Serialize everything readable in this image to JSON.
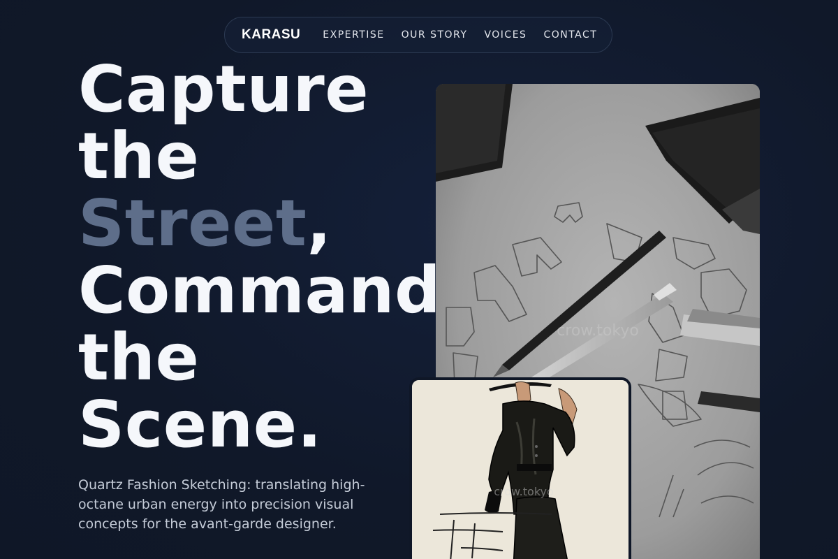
{
  "nav": {
    "brand": "KARASU",
    "links": [
      {
        "label": "EXPERTISE"
      },
      {
        "label": "OUR STORY"
      },
      {
        "label": "VOICES"
      },
      {
        "label": "CONTACT"
      }
    ]
  },
  "hero": {
    "headline": {
      "line1": "Capture",
      "line2": "the",
      "line3_accent": "Street",
      "line3_rest": ",",
      "line4": "Command",
      "line5": "the",
      "line6": "Scene."
    },
    "subtitle": "Quartz Fashion Sketching: translating high-octane urban energy into precision visual concepts for the avant-garde designer."
  },
  "images": {
    "main_alt": "Black and white photo of fashion sketches with pencils and pens on paper",
    "main_watermark": "crow.tokyo",
    "inset_alt": "Fashion illustration of a woman in a black belted jacket and hat",
    "inset_watermark": "crow.tokyo"
  },
  "colors": {
    "background": "#101829",
    "headline": "#f5f7fb",
    "accent": "#5e6e8a",
    "subtitle": "#c5ccd8",
    "nav_border": "#2c3a52"
  }
}
